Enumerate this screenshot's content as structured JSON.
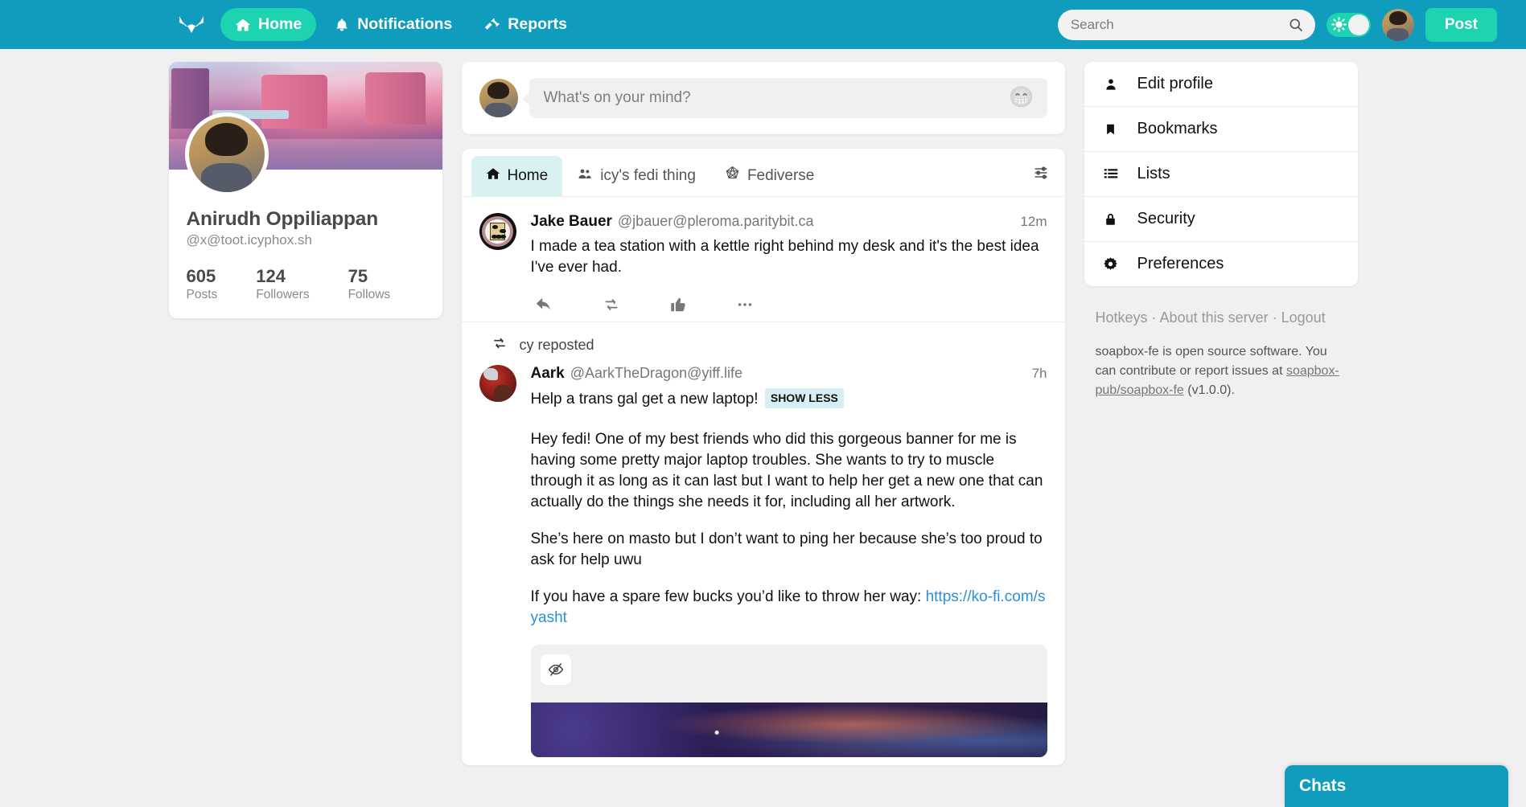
{
  "colors": {
    "header_bg": "#0f9cbd",
    "accent_green": "#1ed3b0",
    "page_bg": "#f0f0f0",
    "link_blue": "#2b90d9",
    "tab_active_bg": "#d7f2f0"
  },
  "topnav": {
    "logo_icon": "fox-logo-icon",
    "items": [
      {
        "label": "Home",
        "icon": "home-icon",
        "active": true
      },
      {
        "label": "Notifications",
        "icon": "bell-icon",
        "active": false
      },
      {
        "label": "Reports",
        "icon": "gavel-icon",
        "active": false
      }
    ],
    "search": {
      "placeholder": "Search",
      "value": "",
      "icon": "search-icon"
    },
    "theme_toggle": {
      "icon": "sun-icon",
      "state": "light"
    },
    "avatar_name": "user-avatar",
    "post_button": "Post"
  },
  "profile": {
    "display_name": "Anirudh Oppiliappan",
    "handle": "@x@toot.icyphox.sh",
    "stats": [
      {
        "value": "605",
        "label": "Posts"
      },
      {
        "value": "124",
        "label": "Followers"
      },
      {
        "value": "75",
        "label": "Follows"
      }
    ]
  },
  "compose": {
    "placeholder": "What's on your mind?",
    "value": "",
    "emoji_icon": "emoji-icon"
  },
  "tabs": {
    "items": [
      {
        "label": "Home",
        "icon": "home-icon",
        "active": true
      },
      {
        "label": "icy's fedi thing",
        "icon": "group-icon",
        "active": false
      },
      {
        "label": "Fediverse",
        "icon": "fediverse-icon",
        "active": false
      }
    ],
    "filter_icon": "sliders-icon"
  },
  "posts": [
    {
      "author": "Jake Bauer",
      "handle": "@jbauer@pleroma.paritybit.ca",
      "time": "12m",
      "body": "I made a tea station with a kettle right behind my desk and it's the best idea I've ever had.",
      "actions": [
        "reply-icon",
        "repost-icon",
        "like-icon",
        "more-icon"
      ]
    },
    {
      "repost_label": "cy reposted",
      "repost_icon": "repost-icon",
      "author": "Aark",
      "handle": "@AarkTheDragon@yiff.life",
      "time": "7h",
      "spoiler": "Help a trans gal get a new laptop!",
      "show_less_label": "SHOW LESS",
      "paragraphs": [
        "Hey fedi! One of my best friends who did this gorgeous banner for me is having some pretty major laptop troubles. She wants to try to muscle through it as long as it can last but I want to help her get a new one that can actually do the things she needs it for, including all her artwork.",
        "She’s here on masto but I don’t want to ping her because she’s too proud to ask for help uwu"
      ],
      "last_line_prefix": "If you have a spare few bucks you’d like to throw her way: ",
      "link_text": "https://ko-fi.com/syasht",
      "media_hide_icon": "eye-slash-icon"
    }
  ],
  "side_menu": {
    "items": [
      {
        "label": "Edit profile",
        "icon": "person-icon"
      },
      {
        "label": "Bookmarks",
        "icon": "bookmark-icon"
      },
      {
        "label": "Lists",
        "icon": "list-icon"
      },
      {
        "label": "Security",
        "icon": "lock-icon"
      },
      {
        "label": "Preferences",
        "icon": "gear-icon"
      }
    ]
  },
  "side_footer": {
    "links": [
      "Hotkeys",
      "About this server",
      "Logout"
    ],
    "separator": " · ",
    "note_part1": "soapbox-fe is open source software. You can contribute or report issues at ",
    "note_link": "soapbox-pub/soapbox-fe",
    "note_part2": " (v1.0.0)."
  },
  "chats": {
    "title": "Chats"
  }
}
